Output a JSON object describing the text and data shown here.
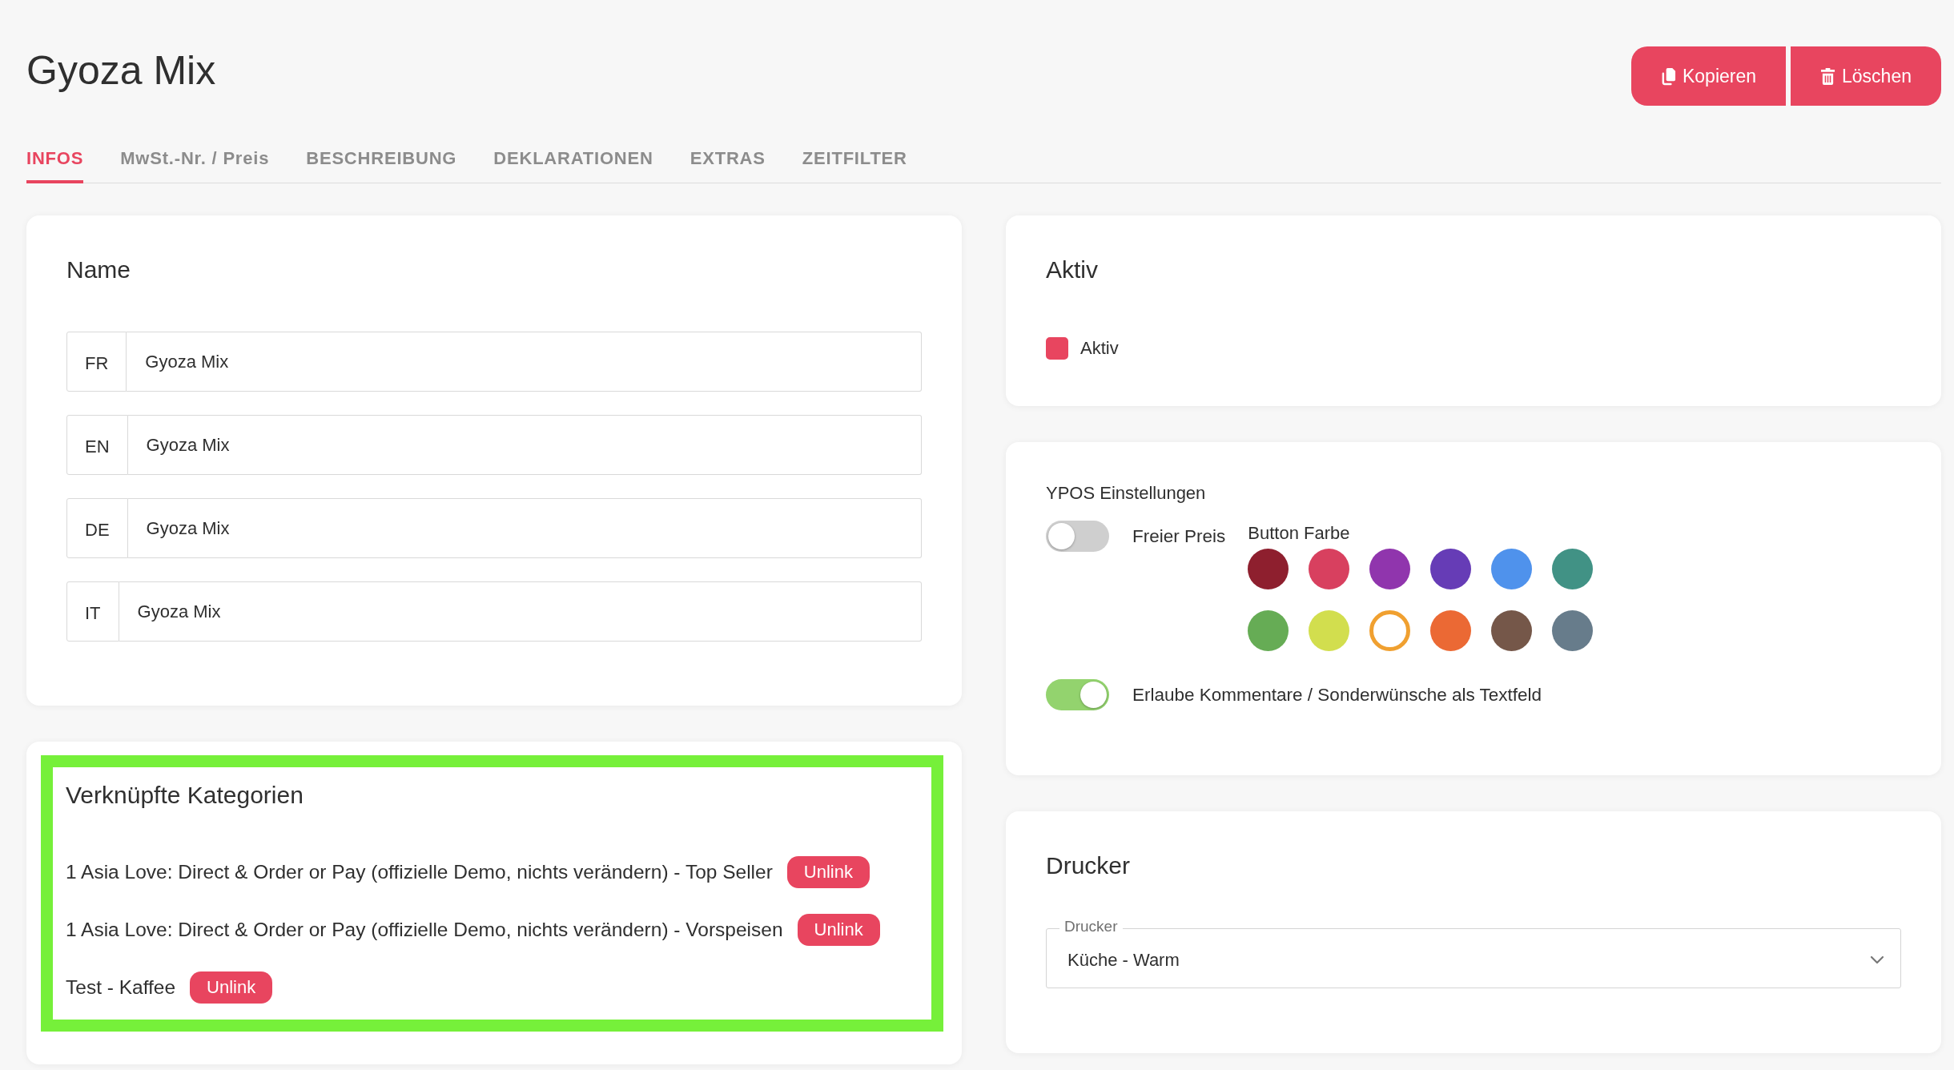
{
  "header": {
    "title": "Gyoza Mix",
    "actions": [
      {
        "label": "Kopieren",
        "kind": "copy"
      },
      {
        "label": "Löschen",
        "kind": "delete"
      }
    ]
  },
  "tabs": [
    {
      "label": "INFOS",
      "selected": true
    },
    {
      "label": "MwSt.-Nr. / Preis",
      "selected": false
    },
    {
      "label": "BESCHREIBUNG",
      "selected": false
    },
    {
      "label": "DEKLARATIONEN",
      "selected": false
    },
    {
      "label": "EXTRAS",
      "selected": false
    },
    {
      "label": "ZEITFILTER",
      "selected": false
    }
  ],
  "name_card": {
    "title": "Name",
    "fields": [
      {
        "language": "FR",
        "value": "Gyoza Mix"
      },
      {
        "language": "EN",
        "value": "Gyoza Mix"
      },
      {
        "language": "DE",
        "value": "Gyoza Mix"
      },
      {
        "language": "IT",
        "value": "Gyoza Mix"
      }
    ]
  },
  "categories_card": {
    "highlighted": true,
    "title": "Verknüpfte Kategorien",
    "links": [
      {
        "label": "1 Asia Love: Direct & Order or Pay (offizielle Demo, nichts verändern) - Top Seller",
        "action": "Unlink"
      },
      {
        "label": "1 Asia Love: Direct & Order or Pay (offizielle Demo, nichts verändern) - Vorspeisen",
        "action": "Unlink"
      },
      {
        "label": "Test - Kaffee",
        "action": "Unlink"
      }
    ]
  },
  "active_card": {
    "title": "Aktiv",
    "checkbox": {
      "label": "Aktiv",
      "checked": true
    }
  },
  "ypos_card": {
    "title": "YPOS Einstellungen",
    "free_price": {
      "label": "Freier Preis",
      "on": false
    },
    "button_color": {
      "label": "Button Farbe",
      "swatches": [
        {
          "color": "#8e1f2e",
          "selected": false
        },
        {
          "color": "#d8405f",
          "selected": false
        },
        {
          "color": "#9035ad",
          "selected": false
        },
        {
          "color": "#663cb6",
          "selected": false
        },
        {
          "color": "#4f92ec",
          "selected": false
        },
        {
          "color": "#419285",
          "selected": false
        },
        {
          "color": "#66ac55",
          "selected": false
        },
        {
          "color": "#d2de4e",
          "selected": false
        },
        {
          "color": "#f0a030",
          "selected": true
        },
        {
          "color": "#eb6934",
          "selected": false
        },
        {
          "color": "#755749",
          "selected": false
        },
        {
          "color": "#677c8b",
          "selected": false
        }
      ]
    },
    "comments": {
      "label": "Erlaube Kommentare / Sonderwünsche als Textfeld",
      "on": true
    }
  },
  "printer_card": {
    "title": "Drucker",
    "select": {
      "label": "Drucker",
      "value": "Küche - Warm"
    }
  }
}
